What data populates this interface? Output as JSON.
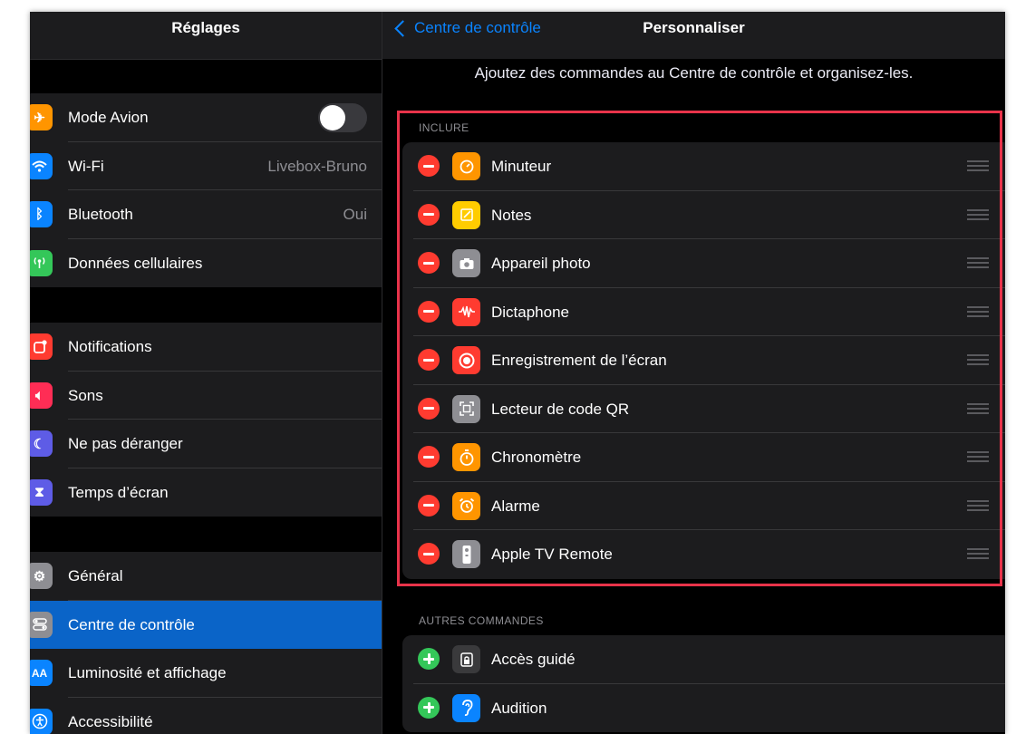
{
  "left": {
    "title": "Réglages",
    "groups": [
      {
        "items": [
          {
            "label": "Mode Avion",
            "icon": "airplane-icon",
            "color": "#ff9500",
            "toggle": false
          },
          {
            "label": "Wi-Fi",
            "icon": "wifi-icon",
            "color": "#0a84ff",
            "value": "Livebox-Bruno"
          },
          {
            "label": "Bluetooth",
            "icon": "bluetooth-icon",
            "color": "#0a84ff",
            "value": "Oui"
          },
          {
            "label": "Données cellulaires",
            "icon": "cellular-icon",
            "color": "#34c759"
          }
        ]
      },
      {
        "items": [
          {
            "label": "Notifications",
            "icon": "notifications-icon",
            "color": "#ff3b30"
          },
          {
            "label": "Sons",
            "icon": "sound-icon",
            "color": "#ff2d55"
          },
          {
            "label": "Ne pas déranger",
            "icon": "moon-icon",
            "color": "#5e5ce6"
          },
          {
            "label": "Temps d’écran",
            "icon": "hourglass-icon",
            "color": "#5e5ce6"
          }
        ]
      },
      {
        "items": [
          {
            "label": "Général",
            "icon": "gear-icon",
            "color": "#8e8e93"
          },
          {
            "label": "Centre de contrôle",
            "icon": "switches-icon",
            "color": "#8e8e93",
            "selected": true
          },
          {
            "label": "Luminosité et affichage",
            "icon": "brightness-icon",
            "color": "#0a84ff"
          },
          {
            "label": "Accessibilité",
            "icon": "accessibility-icon",
            "color": "#0a84ff"
          }
        ]
      }
    ]
  },
  "right": {
    "back_label": "Centre de contrôle",
    "title": "Personnaliser",
    "description": "Ajoutez des commandes au Centre de contrôle et organisez-les.",
    "include_header": "INCLURE",
    "include_items": [
      {
        "label": "Minuteur",
        "icon": "timer-icon",
        "color": "#ff9500"
      },
      {
        "label": "Notes",
        "icon": "notes-icon",
        "color": "#ffcc00"
      },
      {
        "label": "Appareil photo",
        "icon": "camera-icon",
        "color": "#8e8e93"
      },
      {
        "label": "Dictaphone",
        "icon": "voice-memo-icon",
        "color": "#ff3b30"
      },
      {
        "label": "Enregistrement de l’écran",
        "icon": "screen-record-icon",
        "color": "#ff3b30"
      },
      {
        "label": "Lecteur de code QR",
        "icon": "qr-code-icon",
        "color": "#8e8e93"
      },
      {
        "label": "Chronomètre",
        "icon": "stopwatch-icon",
        "color": "#ff9500"
      },
      {
        "label": "Alarme",
        "icon": "alarm-icon",
        "color": "#ff9500"
      },
      {
        "label": "Apple TV Remote",
        "icon": "tv-remote-icon",
        "color": "#8e8e93"
      }
    ],
    "other_header": "AUTRES COMMANDES",
    "other_items": [
      {
        "label": "Accès guidé",
        "icon": "lock-icon",
        "color": "#3a3a3c"
      },
      {
        "label": "Audition",
        "icon": "ear-icon",
        "color": "#0a84ff"
      }
    ]
  }
}
